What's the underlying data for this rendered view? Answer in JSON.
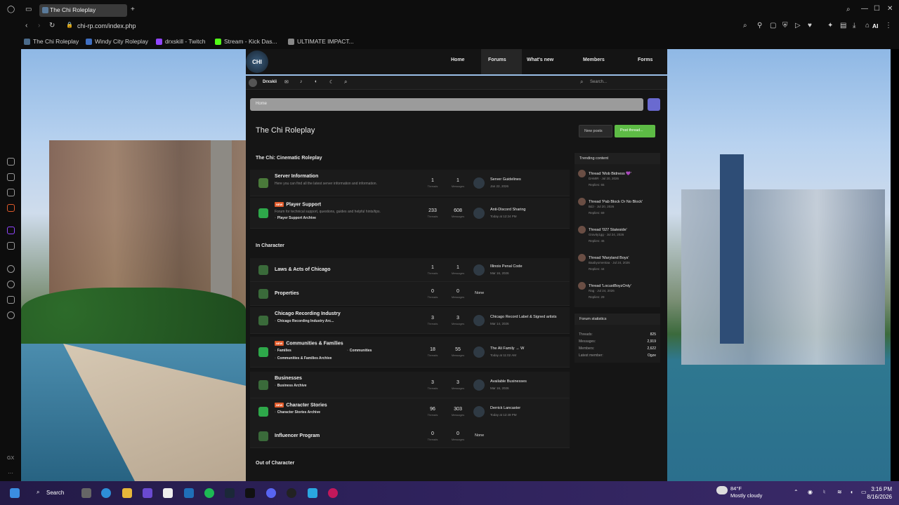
{
  "browser": {
    "tab_title": "The Chi Roleplay",
    "url": "chi-rp.com/index.php",
    "new_tab": "+",
    "bookmarks": [
      {
        "label": "The Chi Roleplay",
        "color": "#4a6a8a"
      },
      {
        "label": "Windy City Roleplay",
        "color": "#3f6fc2"
      },
      {
        "label": "drxskill - Twitch",
        "color": "#9146ff"
      },
      {
        "label": "Stream - Kick Das...",
        "color": "#53fc18"
      },
      {
        "label": "ULTIMATE IMPACT...",
        "color": "#888888"
      }
    ],
    "toolbar_ai": "AI"
  },
  "nav": {
    "logo": "CHI",
    "items": [
      "Home",
      "Forums",
      "What's new",
      "Members",
      "Forms"
    ],
    "active": "Forums"
  },
  "userbar": {
    "username": "Drxskii",
    "search_placeholder": "Search..."
  },
  "breadcrumb": "Home",
  "page_title": "The Chi Roleplay",
  "buttons": {
    "new_posts": "New posts",
    "post_thread": "Post thread..."
  },
  "sections": [
    {
      "title": "The Chi: Cinematic Roleplay",
      "forums": [
        {
          "title": "Server Information",
          "new": false,
          "desc": "Here you can find all the latest server information and information.",
          "subs": [],
          "threads": "1",
          "messages": "1",
          "last_title": "Server Guidelines",
          "last_meta": "Jan 22, 2026",
          "icon": "#4a7a3a"
        },
        {
          "title": "Player Support",
          "new": true,
          "desc": "Forum for technical support, questions, guides and helpful hints/tips.",
          "subs": [
            "Player Support Archive"
          ],
          "threads": "233",
          "messages": "608",
          "last_title": "Anti-Discord Sharing",
          "last_meta": "Today at 12:24 PM",
          "icon": "#2ea84a"
        }
      ]
    },
    {
      "title": "In Character",
      "forums": [
        {
          "title": "Laws & Acts of Chicago",
          "new": false,
          "desc": "",
          "subs": [],
          "threads": "1",
          "messages": "1",
          "last_title": "Illinois Penal Code",
          "last_meta": "Mar 16, 2026",
          "icon": "#3a6a3a"
        },
        {
          "title": "Properties",
          "new": false,
          "desc": "",
          "subs": [],
          "threads": "0",
          "messages": "0",
          "last_title": "None",
          "last_meta": "",
          "icon": "#3a6a3a"
        },
        {
          "title": "Chicago Recording Industry",
          "new": false,
          "desc": "",
          "subs": [
            "Chicago Recording Industry Arc..."
          ],
          "threads": "3",
          "messages": "3",
          "last_title": "Chicago Record Label & Signed artists",
          "last_meta": "Mar 14, 2026",
          "icon": "#3a6a3a"
        },
        {
          "title": "Communities & Families",
          "new": true,
          "desc": "",
          "subs": [
            "Families",
            "Communities",
            "Communities & Families Archive"
          ],
          "threads": "18",
          "messages": "55",
          "last_title": "The Ali Family → W",
          "last_meta": "Today at 11:02 AM",
          "icon": "#2ea84a"
        },
        {
          "title": "Businesses",
          "new": false,
          "desc": "",
          "subs": [
            "Business Archive"
          ],
          "threads": "3",
          "messages": "3",
          "last_title": "Available Businesses",
          "last_meta": "Mar 16, 2026",
          "icon": "#3a6a3a"
        },
        {
          "title": "Character Stories",
          "new": true,
          "desc": "",
          "subs": [
            "Character Stories Archive"
          ],
          "threads": "96",
          "messages": "303",
          "last_title": "Derrick Lancaster",
          "last_meta": "Today at 12:49 PM",
          "icon": "#2ea84a"
        },
        {
          "title": "Influencer Program",
          "new": false,
          "desc": "",
          "subs": [],
          "threads": "0",
          "messages": "0",
          "last_title": "None",
          "last_meta": "",
          "icon": "#3a6a3a"
        }
      ]
    },
    {
      "title": "Out of Character",
      "forums": []
    }
  ],
  "num_labels": {
    "threads": "Threads",
    "messages": "Messages"
  },
  "trending": {
    "title": "Trending content",
    "items": [
      {
        "title": "Thread 'Mob Bidness 💜'",
        "meta": "DAMIR · Jul 20, 2026",
        "replies": "Replies: 65"
      },
      {
        "title": "Thread 'Pab Block Or No Block'",
        "meta": "BdJ · Jul 20, 2026",
        "replies": "Replies: 69"
      },
      {
        "title": "Thread '027 Stateside'",
        "meta": "Gravity1gg · Jul 24, 2026",
        "replies": "Replies: 46"
      },
      {
        "title": "Thread 'Maryland Boys'",
        "meta": "Baabyomentaa · Jul 24, 2026",
        "replies": "Replies: 44"
      },
      {
        "title": "Thread 'LocustBoyzOnly'",
        "meta": "Rag · Jul 24, 2026",
        "replies": "Replies: 29"
      }
    ]
  },
  "stats": {
    "title": "Forum statistics",
    "rows": [
      {
        "label": "Threads:",
        "value": "825"
      },
      {
        "label": "Messages:",
        "value": "2,919"
      },
      {
        "label": "Members:",
        "value": "2,622"
      },
      {
        "label": "Latest member:",
        "value": "Ogze"
      }
    ]
  },
  "taskbar": {
    "search": "Search",
    "weather_temp": "84°F",
    "weather_desc": "Mostly cloudy",
    "time": "3:16 PM",
    "date": "8/16/2026"
  }
}
